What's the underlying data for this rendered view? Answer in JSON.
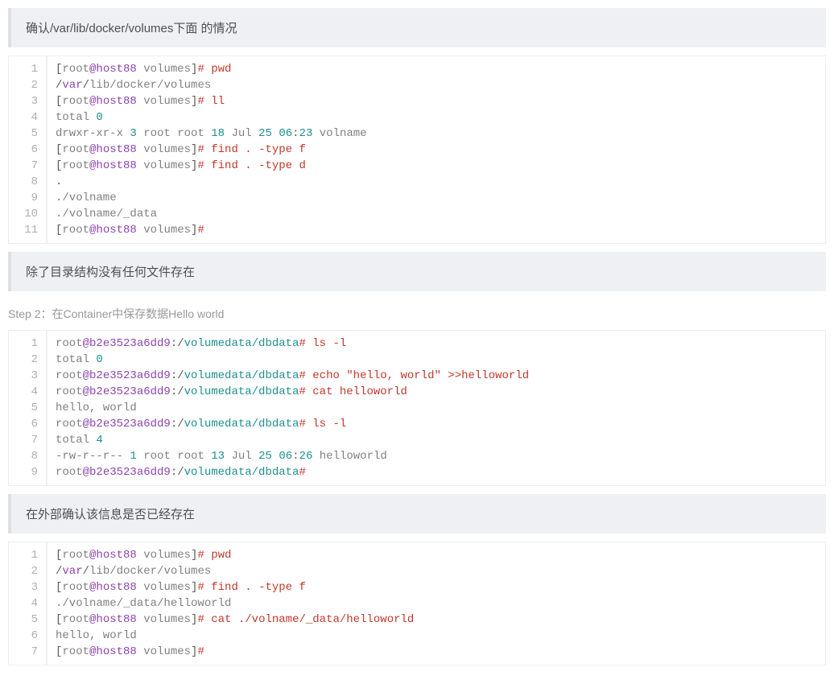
{
  "quote1": "确认/var/lib/docker/volumes下面 的情况",
  "quote2": "除了目录结构没有任何文件存在",
  "step2": "Step 2：在Container中保存数据Hello world",
  "quote3": "在外部确认该信息是否已经存在",
  "block1": [
    [
      [
        "[",
        "plain"
      ],
      [
        "root",
        "gray"
      ],
      [
        "@host88",
        "purple"
      ],
      [
        " ",
        "plain"
      ],
      [
        "volumes",
        "gray"
      ],
      [
        "]",
        "plain"
      ],
      [
        "# pwd",
        "red"
      ]
    ],
    [
      [
        "/",
        "plain"
      ],
      [
        "var",
        "purple"
      ],
      [
        "/",
        "plain"
      ],
      [
        "lib/docker/volumes",
        "gray"
      ]
    ],
    [
      [
        "[",
        "plain"
      ],
      [
        "root",
        "gray"
      ],
      [
        "@host88",
        "purple"
      ],
      [
        " ",
        "plain"
      ],
      [
        "volumes",
        "gray"
      ],
      [
        "]",
        "plain"
      ],
      [
        "# ll",
        "red"
      ]
    ],
    [
      [
        "total",
        "gray"
      ],
      [
        " ",
        "plain"
      ],
      [
        "0",
        "teal"
      ]
    ],
    [
      [
        "drwxr-xr-x",
        "gray"
      ],
      [
        " ",
        "plain"
      ],
      [
        "3",
        "teal"
      ],
      [
        " ",
        "plain"
      ],
      [
        "root root",
        "gray"
      ],
      [
        " ",
        "plain"
      ],
      [
        "18",
        "teal"
      ],
      [
        " ",
        "plain"
      ],
      [
        "Jul",
        "gray"
      ],
      [
        " ",
        "plain"
      ],
      [
        "25",
        "teal"
      ],
      [
        " ",
        "plain"
      ],
      [
        "06",
        "teal"
      ],
      [
        ":",
        "plain"
      ],
      [
        "23",
        "teal"
      ],
      [
        " ",
        "plain"
      ],
      [
        "volname",
        "gray"
      ]
    ],
    [
      [
        "[",
        "plain"
      ],
      [
        "root",
        "gray"
      ],
      [
        "@host88",
        "purple"
      ],
      [
        " ",
        "plain"
      ],
      [
        "volumes",
        "gray"
      ],
      [
        "]",
        "plain"
      ],
      [
        "# find . -type f",
        "red"
      ]
    ],
    [
      [
        "[",
        "plain"
      ],
      [
        "root",
        "gray"
      ],
      [
        "@host88",
        "purple"
      ],
      [
        " ",
        "plain"
      ],
      [
        "volumes",
        "gray"
      ],
      [
        "]",
        "plain"
      ],
      [
        "# find . -type d",
        "red"
      ]
    ],
    [
      [
        ".",
        "plain"
      ]
    ],
    [
      [
        "./volname",
        "gray"
      ]
    ],
    [
      [
        "./volname/_data",
        "gray"
      ]
    ],
    [
      [
        "[",
        "plain"
      ],
      [
        "root",
        "gray"
      ],
      [
        "@host88",
        "purple"
      ],
      [
        " ",
        "plain"
      ],
      [
        "volumes",
        "gray"
      ],
      [
        "]",
        "plain"
      ],
      [
        "#",
        "red"
      ]
    ]
  ],
  "block2": [
    [
      [
        "root",
        "gray"
      ],
      [
        "@b2e3523a6dd9",
        "purple"
      ],
      [
        ":/",
        "plain"
      ],
      [
        "volumedata/dbdata",
        "teal"
      ],
      [
        "# ls -l",
        "red"
      ]
    ],
    [
      [
        "total",
        "gray"
      ],
      [
        " ",
        "plain"
      ],
      [
        "0",
        "teal"
      ]
    ],
    [
      [
        "root",
        "gray"
      ],
      [
        "@b2e3523a6dd9",
        "purple"
      ],
      [
        ":/",
        "plain"
      ],
      [
        "volumedata/dbdata",
        "teal"
      ],
      [
        "# echo \"hello, world\" >>helloworld",
        "red"
      ]
    ],
    [
      [
        "root",
        "gray"
      ],
      [
        "@b2e3523a6dd9",
        "purple"
      ],
      [
        ":/",
        "plain"
      ],
      [
        "volumedata/dbdata",
        "teal"
      ],
      [
        "# cat helloworld",
        "red"
      ]
    ],
    [
      [
        "hello, world",
        "gray"
      ]
    ],
    [
      [
        "root",
        "gray"
      ],
      [
        "@b2e3523a6dd9",
        "purple"
      ],
      [
        ":/",
        "plain"
      ],
      [
        "volumedata/dbdata",
        "teal"
      ],
      [
        "# ls -l",
        "red"
      ]
    ],
    [
      [
        "total",
        "gray"
      ],
      [
        " ",
        "plain"
      ],
      [
        "4",
        "teal"
      ]
    ],
    [
      [
        "-rw-r--r--",
        "gray"
      ],
      [
        " ",
        "plain"
      ],
      [
        "1",
        "teal"
      ],
      [
        " ",
        "plain"
      ],
      [
        "root root",
        "gray"
      ],
      [
        " ",
        "plain"
      ],
      [
        "13",
        "teal"
      ],
      [
        " ",
        "plain"
      ],
      [
        "Jul",
        "gray"
      ],
      [
        " ",
        "plain"
      ],
      [
        "25",
        "teal"
      ],
      [
        " ",
        "plain"
      ],
      [
        "06",
        "teal"
      ],
      [
        ":",
        "plain"
      ],
      [
        "26",
        "teal"
      ],
      [
        " ",
        "plain"
      ],
      [
        "helloworld",
        "gray"
      ]
    ],
    [
      [
        "root",
        "gray"
      ],
      [
        "@b2e3523a6dd9",
        "purple"
      ],
      [
        ":/",
        "plain"
      ],
      [
        "volumedata/dbdata",
        "teal"
      ],
      [
        "#",
        "red"
      ]
    ]
  ],
  "block3": [
    [
      [
        "[",
        "plain"
      ],
      [
        "root",
        "gray"
      ],
      [
        "@host88",
        "purple"
      ],
      [
        " ",
        "plain"
      ],
      [
        "volumes",
        "gray"
      ],
      [
        "]",
        "plain"
      ],
      [
        "# pwd",
        "red"
      ]
    ],
    [
      [
        "/",
        "plain"
      ],
      [
        "var",
        "purple"
      ],
      [
        "/",
        "plain"
      ],
      [
        "lib/docker/volumes",
        "gray"
      ]
    ],
    [
      [
        "[",
        "plain"
      ],
      [
        "root",
        "gray"
      ],
      [
        "@host88",
        "purple"
      ],
      [
        " ",
        "plain"
      ],
      [
        "volumes",
        "gray"
      ],
      [
        "]",
        "plain"
      ],
      [
        "# find . -type f",
        "red"
      ]
    ],
    [
      [
        "./volname/_data/helloworld",
        "gray"
      ]
    ],
    [
      [
        "[",
        "plain"
      ],
      [
        "root",
        "gray"
      ],
      [
        "@host88",
        "purple"
      ],
      [
        " ",
        "plain"
      ],
      [
        "volumes",
        "gray"
      ],
      [
        "]",
        "plain"
      ],
      [
        "# cat ./volname/_data/helloworld",
        "red"
      ]
    ],
    [
      [
        "hello, world",
        "gray"
      ]
    ],
    [
      [
        "[",
        "plain"
      ],
      [
        "root",
        "gray"
      ],
      [
        "@host88",
        "purple"
      ],
      [
        " ",
        "plain"
      ],
      [
        "volumes",
        "gray"
      ],
      [
        "]",
        "plain"
      ],
      [
        "#",
        "red"
      ]
    ]
  ]
}
